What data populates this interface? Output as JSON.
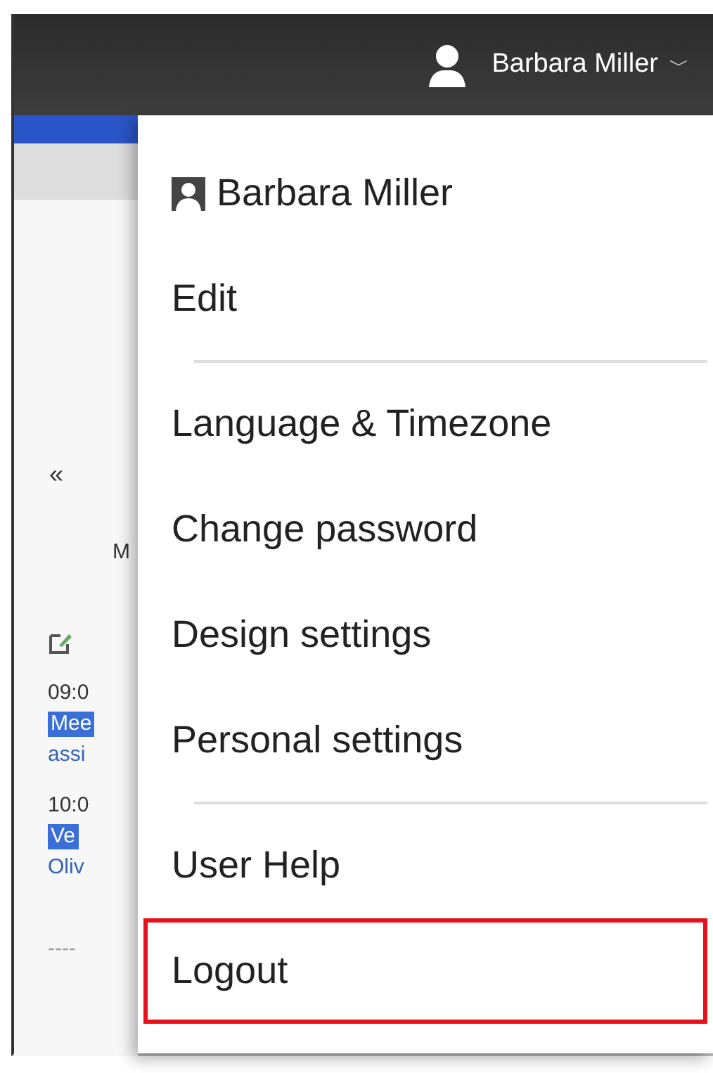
{
  "header": {
    "user_name": "Barbara Miller",
    "caret": "﹀"
  },
  "background": {
    "collapse_icon": "«",
    "column_heading": "M",
    "entries": [
      {
        "kind": "time",
        "text": "09:0"
      },
      {
        "kind": "tag",
        "text": "Mee"
      },
      {
        "kind": "link",
        "text": "assi"
      },
      {
        "kind": "time",
        "text": "10:0"
      },
      {
        "kind": "tag",
        "text": "Ve"
      },
      {
        "kind": "link",
        "text": "Oliv"
      },
      {
        "kind": "dashes",
        "text": "----"
      }
    ]
  },
  "menu": {
    "items": [
      {
        "kind": "user",
        "label": "Barbara Miller",
        "highlighted": false
      },
      {
        "kind": "item",
        "label": "Edit",
        "highlighted": false
      },
      {
        "kind": "divider"
      },
      {
        "kind": "item",
        "label": "Language & Timezone",
        "highlighted": false
      },
      {
        "kind": "item",
        "label": "Change password",
        "highlighted": false
      },
      {
        "kind": "item",
        "label": "Design settings",
        "highlighted": false
      },
      {
        "kind": "item",
        "label": "Personal settings",
        "highlighted": false
      },
      {
        "kind": "divider"
      },
      {
        "kind": "item",
        "label": "User Help",
        "highlighted": false
      },
      {
        "kind": "item",
        "label": "Logout",
        "highlighted": true
      }
    ]
  }
}
